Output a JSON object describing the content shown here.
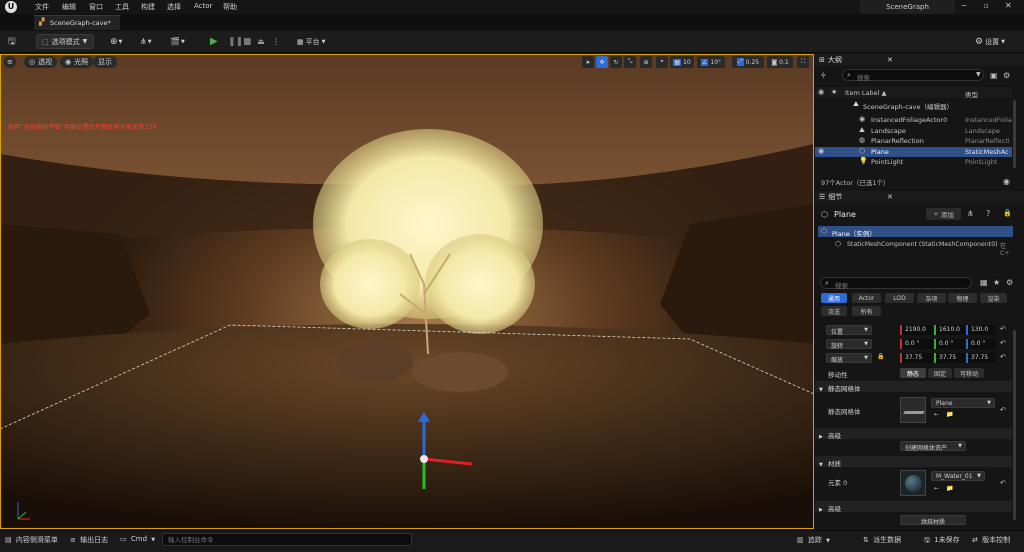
{
  "menu": {
    "items": [
      "文件",
      "编辑",
      "窗口",
      "工具",
      "构建",
      "选择",
      "Actor",
      "帮助"
    ]
  },
  "app": {
    "project_name": "SceneGraph",
    "doc_tab": "SceneGraph-cave*"
  },
  "toolbar": {
    "mode_label": "选项模式",
    "platform_label": "平台",
    "settings_label": "设置"
  },
  "viewport": {
    "perspective_label": "透视",
    "lit_label": "光照",
    "show_label": "显示",
    "grid_snap": "10",
    "rot_snap": "10°",
    "scale_snap": "0.25",
    "camera_speed": "0.1",
    "warning_text": "启用“全局裁切平面”项目设置后平面反射才能正常工作"
  },
  "outliner": {
    "title": "大纲",
    "search_placeholder": "搜索",
    "col_label": "Item Label ▲",
    "col_type": "类型",
    "rows": [
      {
        "label": "SceneGraph-cave（编辑器）",
        "type": ""
      },
      {
        "label": "InstancedFoliageActor0",
        "type": "InstancedFolia"
      },
      {
        "label": "Landscape",
        "type": "Landscape"
      },
      {
        "label": "PlanarReflection",
        "type": "PlanarReflecti"
      },
      {
        "label": "Plane",
        "type": "StaticMeshAc"
      },
      {
        "label": "PointLight",
        "type": "PointLight"
      }
    ],
    "actor_count": "97个Actor（已选1个）"
  },
  "details": {
    "title": "细节",
    "actor_name": "Plane",
    "add_label": "添加",
    "instance_row": "Plane（实例）",
    "component_row": "StaticMeshComponent (StaticMeshComponent0)",
    "component_suffix": "在C+",
    "search_placeholder": "搜索",
    "filters_row1": [
      "通用",
      "Actor",
      "LOD",
      "杂项",
      "物理",
      "渲染"
    ],
    "filters_row2": [
      "流送",
      "所有"
    ],
    "transform": {
      "location_label": "位置",
      "rotation_label": "旋转",
      "scale_label": "缩放",
      "mobility_label": "移动性",
      "location": [
        "2190.0",
        "1610.0",
        "130.0"
      ],
      "rotation": [
        "0.0 °",
        "0.0 °",
        "0.0 °"
      ],
      "scale": [
        "37.75",
        "37.75",
        "37.75"
      ],
      "mobility": [
        "静态",
        "固定",
        "可移动"
      ]
    },
    "sections": {
      "static_mesh": "静态网格体",
      "static_mesh_label": "静态网格体",
      "static_mesh_value": "Plane",
      "advanced": "高级",
      "create_blueprint": "创建网格体资产",
      "materials": "材质",
      "element_label": "元素 0",
      "material_value": "M_Water_01",
      "advanced2": "高级",
      "advanced_material": "烘焙材质"
    }
  },
  "bottom": {
    "content_drawer": "内容侧滑菜单",
    "output_log": "输出日志",
    "cmd_label": "Cmd",
    "cmd_placeholder": "输入控制台命令",
    "trace": "追踪",
    "derived_data": "派生数据",
    "unsaved": "1未保存",
    "source_control": "版本控制"
  },
  "colors": {
    "accent": "#2f6bd6",
    "selected_row": "#2f4f86",
    "play": "#4caf50",
    "viewport_border": "#d8a000",
    "warning": "#ff3c2e"
  }
}
